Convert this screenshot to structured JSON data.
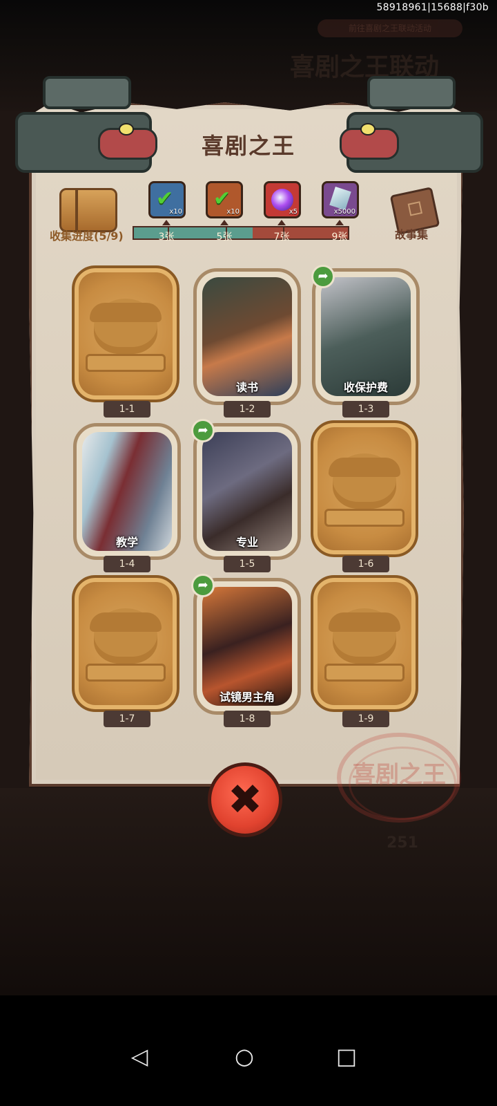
{
  "status": {
    "watermark": "58918961|15688|f30b"
  },
  "background": {
    "title": "喜剧之王联动",
    "notice": "前往喜剧之王联动活动",
    "count": "251"
  },
  "panel": {
    "title": "喜剧之王",
    "collection_progress": "收集进度(5/9)",
    "story_label": "故事集",
    "stamp_text": "喜剧之王"
  },
  "progress": {
    "collected": 5,
    "total": 9
  },
  "rewards": [
    {
      "icon": "ticket-card-icon",
      "qty": "x10",
      "threshold": "3张",
      "claimed": true,
      "color": "#3f6fa0"
    },
    {
      "icon": "ticket-card-icon",
      "qty": "x10",
      "threshold": "5张",
      "claimed": true,
      "color": "#b0582c"
    },
    {
      "icon": "magic-orb-icon",
      "qty": "x5",
      "threshold": "7张",
      "claimed": false,
      "color": "#c43a35"
    },
    {
      "icon": "crystal-gem-icon",
      "qty": "x5000",
      "threshold": "9张",
      "claimed": false,
      "color": "#7a4a8f"
    }
  ],
  "cards": [
    {
      "id": "1-1",
      "title": "",
      "unlocked": false,
      "share": false
    },
    {
      "id": "1-2",
      "title": "读书",
      "unlocked": true,
      "share": false
    },
    {
      "id": "1-3",
      "title": "收保护费",
      "unlocked": true,
      "share": true
    },
    {
      "id": "1-4",
      "title": "教学",
      "unlocked": true,
      "share": false
    },
    {
      "id": "1-5",
      "title": "专业",
      "unlocked": true,
      "share": true
    },
    {
      "id": "1-6",
      "title": "",
      "unlocked": false,
      "share": false
    },
    {
      "id": "1-7",
      "title": "",
      "unlocked": false,
      "share": false
    },
    {
      "id": "1-8",
      "title": "试镜男主角",
      "unlocked": true,
      "share": true
    },
    {
      "id": "1-9",
      "title": "",
      "unlocked": false,
      "share": false
    }
  ],
  "close_button": {
    "icon": "close-x-icon",
    "label": "✖"
  },
  "nav": {
    "back": "◁",
    "home": "○",
    "recents": "□"
  },
  "colors": {
    "accent": "#e1432f",
    "paper": "#d9cebe",
    "title": "#5a3a2b",
    "share": "#4c9b3e"
  }
}
